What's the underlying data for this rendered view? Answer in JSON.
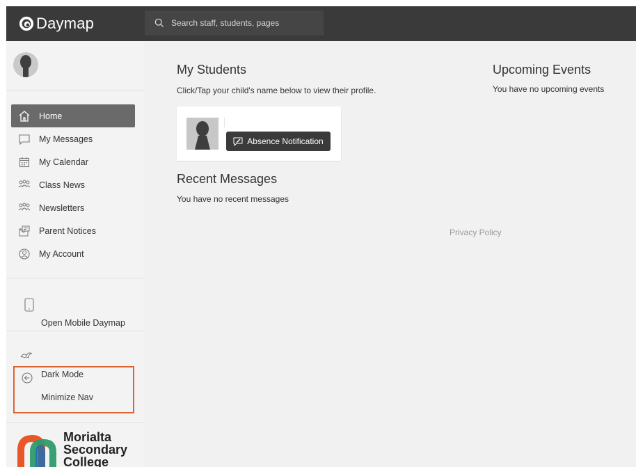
{
  "app": {
    "brand": "Daymap"
  },
  "search": {
    "placeholder": "Search staff, students, pages"
  },
  "sidebar": {
    "items": [
      {
        "label": "Home",
        "icon": "home-icon",
        "active": true
      },
      {
        "label": "My Messages",
        "icon": "message-icon",
        "active": false
      },
      {
        "label": "My Calendar",
        "icon": "calendar-icon",
        "active": false
      },
      {
        "label": "Class News",
        "icon": "group-icon",
        "active": false
      },
      {
        "label": "Newsletters",
        "icon": "group-icon",
        "active": false
      },
      {
        "label": "Parent Notices",
        "icon": "notice-icon",
        "active": false
      },
      {
        "label": "My Account",
        "icon": "account-icon",
        "active": false
      }
    ],
    "mobile_label": "Open Mobile Daymap",
    "dark_mode_label": "Dark Mode",
    "minimize_label": "Minimize Nav",
    "school_name_line1": "Morialta",
    "school_name_line2": "Secondary",
    "school_name_line3": "College"
  },
  "main": {
    "students_title": "My Students",
    "students_subtitle": "Click/Tap your child's name below to view their profile.",
    "absence_button": "Absence Notification",
    "messages_title": "Recent Messages",
    "messages_empty": "You have no recent messages",
    "events_title": "Upcoming Events",
    "events_empty": "You have no upcoming events",
    "privacy_link": "Privacy Policy"
  },
  "colors": {
    "topbar": "#3a3a3a",
    "active_nav": "#6a6a6a",
    "highlight_border": "#e0632f",
    "background": "#f1f1f1"
  }
}
